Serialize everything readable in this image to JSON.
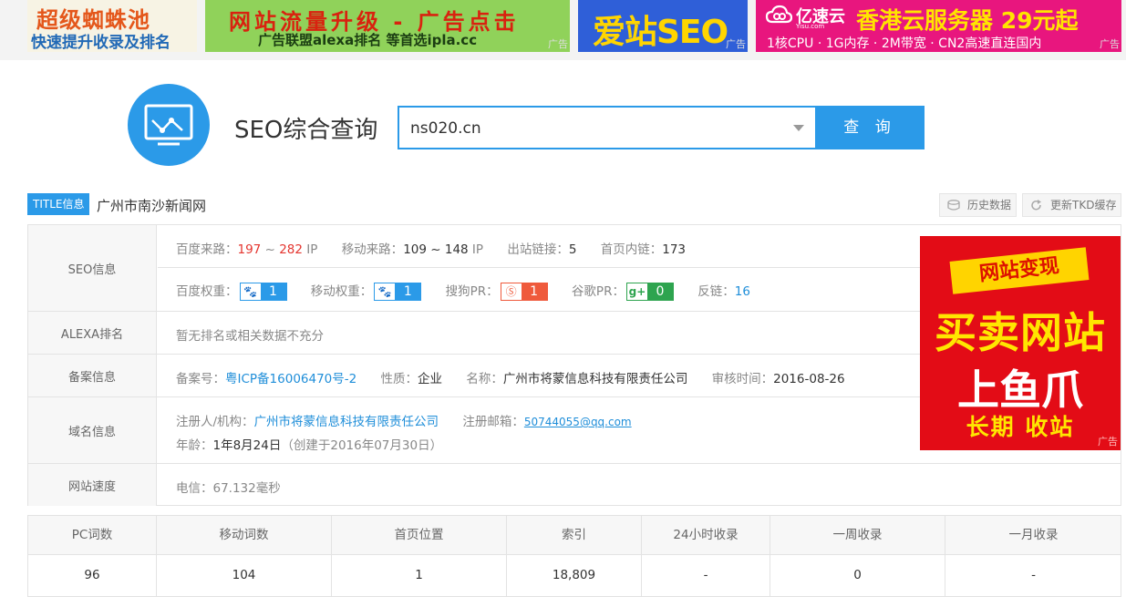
{
  "ads": {
    "ad1": {
      "line1": "超级蜘蛛池",
      "line2": "快速提升收录及排名"
    },
    "ad2": {
      "line1": "网站流量升级 - 广告点击",
      "line2": "广告联盟alexa排名 等首选ipla.cc",
      "tag": "广告"
    },
    "ad3": {
      "line1": "爱站SEO",
      "tag": "广告"
    },
    "ad4": {
      "brand": "亿速云",
      "brand_sub": "Yisu.com",
      "line1": "香港云服务器 29元起",
      "line2": "1核CPU · 1G内存 · 2M带宽 · CN2高速直连国内",
      "tag": "广告"
    },
    "side": {
      "ribbon": "网站变现",
      "line1": "买卖网站",
      "line2": "上鱼爪",
      "line3": "长期 收站",
      "tag": "广告"
    }
  },
  "tool": {
    "title": "SEO综合查询"
  },
  "search": {
    "value": "ns020.cn",
    "button": "查 询"
  },
  "title_info": {
    "tag": "TITLE信息",
    "text": "广州市南沙新闻网"
  },
  "actions": {
    "history": "历史数据",
    "refresh": "更新TKD缓存"
  },
  "seo": {
    "label": "SEO信息",
    "baidu_source_label": "百度来路：",
    "baidu_source_low": "197",
    "baidu_source_sep": " ~ ",
    "baidu_source_high": "282",
    "baidu_source_unit": " IP",
    "mobile_source_label": "移动来路：",
    "mobile_source_value": "109 ~ 148",
    "mobile_source_unit": " IP",
    "outlinks_label": "出站链接：",
    "outlinks_value": "5",
    "inlinks_label": "首页内链：",
    "inlinks_value": "173",
    "baidu_weight_label": "百度权重：",
    "baidu_weight_value": "1",
    "mobile_weight_label": "移动权重：",
    "mobile_weight_value": "1",
    "sogou_pr_label": "搜狗PR：",
    "sogou_pr_value": "1",
    "google_pr_label": "谷歌PR：",
    "google_pr_value": "0",
    "backlinks_label": "反链：",
    "backlinks_value": "16"
  },
  "alexa": {
    "label": "ALEXA排名",
    "text": "暂无排名或相关数据不充分"
  },
  "icp": {
    "label": "备案信息",
    "number_label": "备案号：",
    "number_value": "粤ICP备16006470号-2",
    "nature_label": "性质：",
    "nature_value": "企业",
    "name_label": "名称：",
    "name_value": "广州市将蒙信息科技有限责任公司",
    "audit_label": "审核时间：",
    "audit_value": "2016-08-26"
  },
  "domain": {
    "label": "域名信息",
    "registrant_label": "注册人/机构：",
    "registrant_value": "广州市将蒙信息科技有限责任公司",
    "email_label": "注册邮箱：",
    "email_value": "50744055@qq.com",
    "age_label": "年龄：",
    "age_value": "1年8月24日",
    "created": "（创建于2016年07月30日）"
  },
  "speed": {
    "label": "网站速度",
    "text": "电信：67.132毫秒"
  },
  "stats": {
    "headers": [
      "PC词数",
      "移动词数",
      "首页位置",
      "索引",
      "24小时收录",
      "一周收录",
      "一月收录"
    ],
    "values": [
      "96",
      "104",
      "1",
      "18,809",
      "-",
      "0",
      "-"
    ]
  },
  "colors": {
    "accent": "#2b9ae8",
    "red": "#e4352f",
    "green": "#2ea44f"
  },
  "icons": {
    "baidu": "paw-icon",
    "sogou": "sogou-s-icon",
    "google": "google-plus-icon"
  }
}
